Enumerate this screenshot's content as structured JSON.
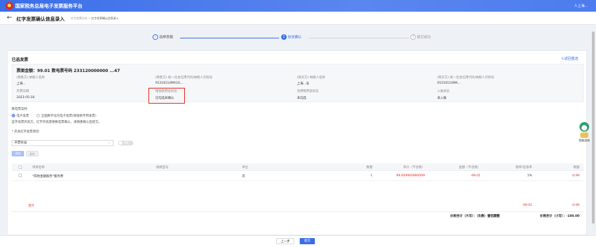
{
  "topbar": {
    "title": "国家税务总局电子发票服务平台",
    "user": "人上海..."
  },
  "header": {
    "back_icon": "←",
    "title": "红字发票确认信息录入",
    "crumbs": [
      "红字发票业务",
      ">",
      "红字发票确认信息录入"
    ]
  },
  "steps": [
    {
      "label": "选择票据",
      "num": "✓",
      "state": "done"
    },
    {
      "label": "信息确认",
      "num": "2",
      "state": "active"
    },
    {
      "label": "提交成功",
      "num": "3",
      "state": "todo"
    }
  ],
  "section": {
    "title": "已选发票",
    "return_link": "↻返回重选"
  },
  "invoice": {
    "heading": "票面金额：99.01    数电票号码 233120000000        ...47",
    "fields": [
      {
        "label": "(销售方) 纳税人名称",
        "value": "上海..."
      },
      {
        "label": "(销售方) 统一社会信用代码/纳税人识别号",
        "value": "91310114MA1G..."
      },
      {
        "label": "(购买方) 纳税人名称",
        "value": "上海...号"
      },
      {
        "label": "(购买方) 统一社会信用代码/纳税人识别号",
        "value": "91310114MA..."
      },
      {
        "label": "开票日期",
        "value": "2023-05-18"
      },
      {
        "label": "增值税用途状态",
        "value": "已勾选未确认"
      },
      {
        "label": "消费税用途状态",
        "value": "未勾选"
      },
      {
        "label": "入账状态",
        "value": "未入账"
      }
    ]
  },
  "options": {
    "title": "数电票案例",
    "radio1": "电子发票",
    "radio2": "全面数字化的电子发票(增值税专用发票)",
    "note": "蓝字发票开具方，红字开具需要数电票确认，请慎重确认后提交。",
    "reason_label": "* 开具红字发票原因",
    "reason_value": "开票有误",
    "toggle_label": "全额"
  },
  "buttons": {
    "add": "添加",
    "delete": "删除"
  },
  "table": {
    "headers": [
      "项目名称",
      "规格型号",
      "单位",
      "数量",
      "单价（不含税）",
      "金额（不含税）",
      "税率/征收率",
      "税额"
    ],
    "rows": [
      {
        "name": "*其他金融服务*服务费",
        "spec": "",
        "unit": "次",
        "qty": "-1",
        "price": "99.009900990099",
        "amount": "-99.01",
        "rate": "1%",
        "tax": "-0.99"
      }
    ],
    "total_label": "合计",
    "total_amount": "-99.01",
    "total_tax": "-0.99"
  },
  "summary": {
    "caps_label": "价税合计（大写）：（负数）壹佰圆整",
    "small_label": "价税合计（小写）：-100.00"
  },
  "footer": {
    "prev": "上一步",
    "submit": "提交"
  },
  "assistant": {
    "label": "智能咨询"
  },
  "colors": {
    "primary": "#3a6ee8",
    "danger": "#e3261e"
  }
}
